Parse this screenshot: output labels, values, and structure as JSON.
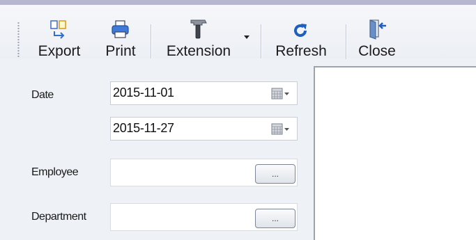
{
  "toolbar": {
    "buttons": [
      {
        "id": "export",
        "label": "Export",
        "icon": "export-icon"
      },
      {
        "id": "print",
        "label": "Print",
        "icon": "printer-icon"
      },
      {
        "id": "extension",
        "label": "Extension",
        "icon": "hammer-icon"
      },
      {
        "id": "refresh",
        "label": "Refresh",
        "icon": "refresh-icon"
      },
      {
        "id": "close",
        "label": "Close",
        "icon": "door-exit-icon"
      }
    ]
  },
  "filters": {
    "date_label": "Date",
    "date_from": "2015-11-01",
    "date_to": "2015-11-27",
    "employee_label": "Employee",
    "employee_value": "",
    "department_label": "Department",
    "department_value": "",
    "browse_label": "..."
  },
  "colors": {
    "accent": "#1f5fbf",
    "background": "#eef1f6",
    "field_bg": "#ffffff"
  }
}
